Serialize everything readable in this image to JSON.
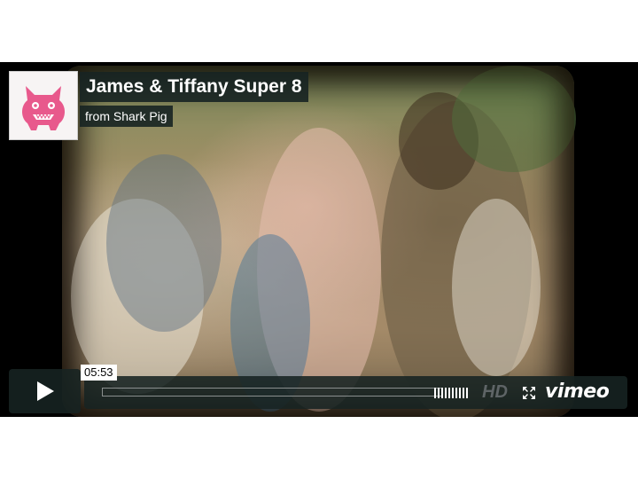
{
  "video": {
    "title": "James & Tiffany Super 8",
    "byline": "from Shark Pig",
    "timecode": "05:53"
  },
  "controls": {
    "hd_label": "HD",
    "brand": "vimeo",
    "volume_bars": 10
  },
  "colors": {
    "overlay": "#172322",
    "logo_pink": "#e8598c"
  },
  "icons": [
    "pig-logo-icon",
    "play-icon",
    "fullscreen-icon"
  ]
}
